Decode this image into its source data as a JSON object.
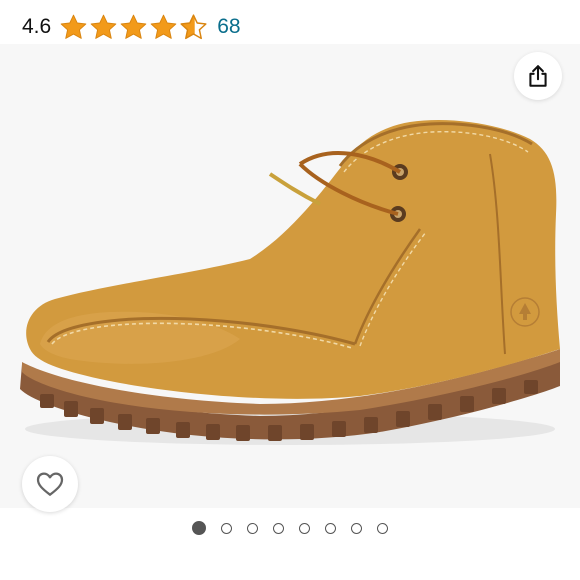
{
  "rating": {
    "value": "4.6",
    "stars": [
      1,
      1,
      1,
      1,
      0.6
    ],
    "review_count": "68"
  },
  "colors": {
    "star_fill": "#f29a1a",
    "star_empty": "#ffffff",
    "review_link": "#0a6e8c",
    "boot_leather": "#d29a3e",
    "sole": "#8a5a3a"
  },
  "icons": {
    "share": "share-icon",
    "wishlist": "heart-outline-icon",
    "logo": "tree-logo-icon"
  },
  "carousel": {
    "total_images": 8,
    "active_index": 0
  }
}
